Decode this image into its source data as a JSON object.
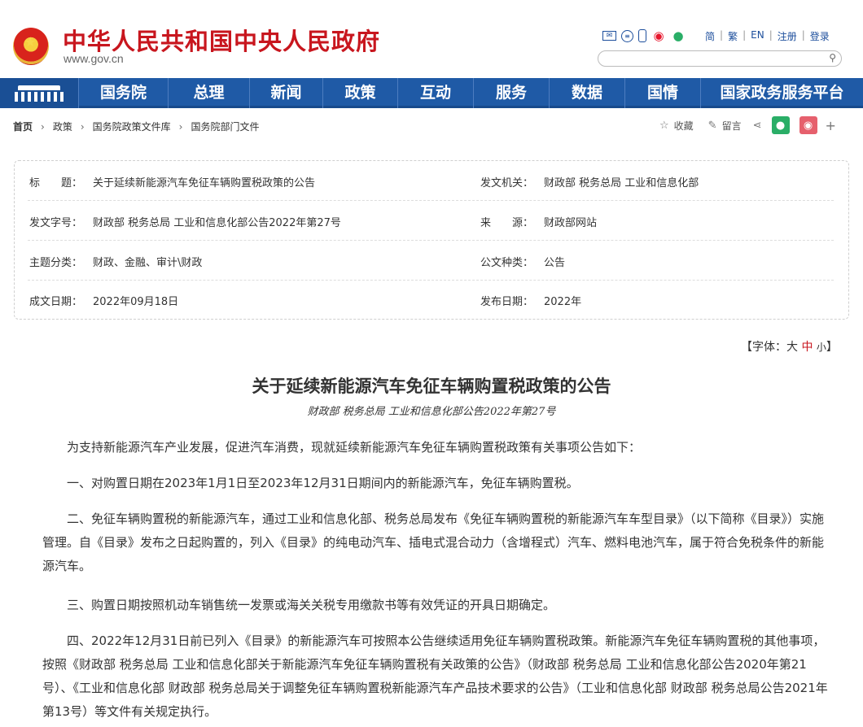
{
  "header": {
    "title": "中华人民共和国中央人民政府",
    "url": "www.gov.cn",
    "links": [
      "简",
      "繁",
      "EN",
      "注册",
      "登录"
    ],
    "icons": [
      "mail-icon",
      "rss-icon",
      "phone-icon",
      "weibo-icon",
      "wechat-icon"
    ],
    "search_placeholder": ""
  },
  "nav": {
    "items": [
      "国务院",
      "总理",
      "新闻",
      "政策",
      "互动",
      "服务",
      "数据",
      "国情",
      "国家政务服务平台"
    ]
  },
  "breadcrumb": [
    "首页",
    "政策",
    "国务院政策文件库",
    "国务院部门文件"
  ],
  "tools": {
    "favorite": "收藏",
    "comment": "留言",
    "plus": "+"
  },
  "meta": {
    "title_label": "标　　题：",
    "title_value": "关于延续新能源汽车免征车辆购置税政策的公告",
    "issuer_label": "发文机关：",
    "issuer_value": "财政部  税务总局  工业和信息化部",
    "docno_label": "发文字号：",
    "docno_value": "财政部  税务总局  工业和信息化部公告2022年第27号",
    "source_label": "来　　源：",
    "source_value": "财政部网站",
    "topic_label": "主题分类：",
    "topic_value": "财政、金融、审计\\财政",
    "type_label": "公文种类：",
    "type_value": "公告",
    "written_label": "成文日期：",
    "written_value": "2022年09月18日",
    "publish_label": "发布日期：",
    "publish_value": "2022年"
  },
  "fontsize": {
    "prefix": "【字体：",
    "large": "大",
    "medium": "中",
    "small": "小",
    "suffix": "】"
  },
  "article": {
    "title": "关于延续新能源汽车免征车辆购置税政策的公告",
    "subtitle": "财政部  税务总局  工业和信息化部公告2022年第27号",
    "p1": "为支持新能源汽车产业发展，促进汽车消费，现就延续新能源汽车免征车辆购置税政策有关事项公告如下：",
    "p2": "一、对购置日期在2023年1月1日至2023年12月31日期间内的新能源汽车，免征车辆购置税。",
    "p3": "二、免征车辆购置税的新能源汽车，通过工业和信息化部、税务总局发布《免征车辆购置税的新能源汽车车型目录》（以下简称《目录》）实施管理。自《目录》发布之日起购置的，列入《目录》的纯电动汽车、插电式混合动力（含增程式）汽车、燃料电池汽车，属于符合免税条件的新能源汽车。",
    "p4": "三、购置日期按照机动车销售统一发票或海关关税专用缴款书等有效凭证的开具日期确定。",
    "p5": "四、2022年12月31日前已列入《目录》的新能源汽车可按照本公告继续适用免征车辆购置税政策。新能源汽车免征车辆购置税的其他事项，按照《财政部 税务总局 工业和信息化部关于新能源汽车免征车辆购置税有关政策的公告》（财政部 税务总局 工业和信息化部公告2020年第21号）、《工业和信息化部 财政部 税务总局关于调整免征车辆购置税新能源汽车产品技术要求的公告》（工业和信息化部 财政部 税务总局公告2021年第13号）等文件有关规定执行。"
  },
  "colors": {
    "brand_red": "#c8161e",
    "nav_blue": "#1f5aa6",
    "link_blue": "#1c4e9c"
  }
}
